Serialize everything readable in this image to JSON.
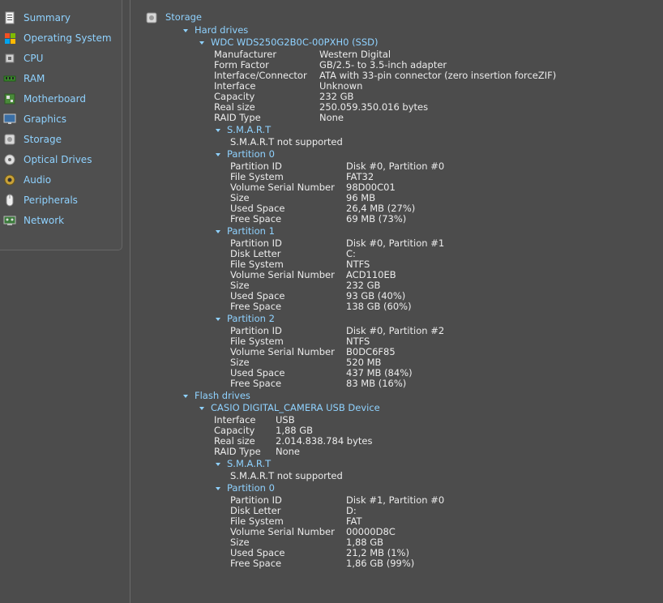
{
  "sidebar": {
    "items": [
      {
        "label": "Summary",
        "icon": "summary-icon"
      },
      {
        "label": "Operating System",
        "icon": "windows-icon"
      },
      {
        "label": "CPU",
        "icon": "cpu-icon"
      },
      {
        "label": "RAM",
        "icon": "ram-icon"
      },
      {
        "label": "Motherboard",
        "icon": "motherboard-icon"
      },
      {
        "label": "Graphics",
        "icon": "monitor-icon"
      },
      {
        "label": "Storage",
        "icon": "hard-drive-icon"
      },
      {
        "label": "Optical Drives",
        "icon": "optical-disc-icon"
      },
      {
        "label": "Audio",
        "icon": "speaker-icon"
      },
      {
        "label": "Peripherals",
        "icon": "mouse-icon"
      },
      {
        "label": "Network",
        "icon": "network-icon"
      }
    ]
  },
  "main": {
    "title": "Storage",
    "hard_drives": {
      "label": "Hard drives",
      "device": {
        "name": "WDC WDS250G2B0C-00PXH0 (SSD)",
        "props": [
          {
            "k": "Manufacturer",
            "v": "Western Digital"
          },
          {
            "k": "Form Factor",
            "v": "GB/2.5- to 3.5-inch adapter"
          },
          {
            "k": "Interface/Connector",
            "v": "ATA with 33-pin connector (zero insertion forceZIF)"
          },
          {
            "k": "Interface",
            "v": "Unknown"
          },
          {
            "k": "Capacity",
            "v": "232 GB"
          },
          {
            "k": "Real size",
            "v": "250.059.350.016 bytes"
          },
          {
            "k": "RAID Type",
            "v": "None"
          }
        ],
        "smart": {
          "label": "S.M.A.R.T",
          "text": "S.M.A.R.T not supported"
        },
        "partitions": [
          {
            "label": "Partition 0",
            "props": [
              {
                "k": "Partition ID",
                "v": "Disk #0, Partition #0"
              },
              {
                "k": "File System",
                "v": "FAT32"
              },
              {
                "k": "Volume Serial Number",
                "v": "98D00C01"
              },
              {
                "k": "Size",
                "v": "96 MB"
              },
              {
                "k": "Used Space",
                "v": "26,4 MB (27%)"
              },
              {
                "k": "Free Space",
                "v": "69 MB (73%)"
              }
            ]
          },
          {
            "label": "Partition 1",
            "props": [
              {
                "k": "Partition ID",
                "v": "Disk #0, Partition #1"
              },
              {
                "k": "Disk Letter",
                "v": "C:"
              },
              {
                "k": "File System",
                "v": "NTFS"
              },
              {
                "k": "Volume Serial Number",
                "v": "ACD110EB"
              },
              {
                "k": "Size",
                "v": "232 GB"
              },
              {
                "k": "Used Space",
                "v": "93 GB (40%)"
              },
              {
                "k": "Free Space",
                "v": "138 GB (60%)"
              }
            ]
          },
          {
            "label": "Partition 2",
            "props": [
              {
                "k": "Partition ID",
                "v": "Disk #0, Partition #2"
              },
              {
                "k": "File System",
                "v": "NTFS"
              },
              {
                "k": "Volume Serial Number",
                "v": "B0DC6F85"
              },
              {
                "k": "Size",
                "v": "520 MB"
              },
              {
                "k": "Used Space",
                "v": "437 MB (84%)"
              },
              {
                "k": "Free Space",
                "v": "83 MB (16%)"
              }
            ]
          }
        ]
      }
    },
    "flash_drives": {
      "label": "Flash drives",
      "device": {
        "name": "CASIO DIGITAL_CAMERA USB Device",
        "props": [
          {
            "k": "Interface",
            "v": "USB"
          },
          {
            "k": "Capacity",
            "v": "1,88 GB"
          },
          {
            "k": "Real size",
            "v": "2.014.838.784 bytes"
          },
          {
            "k": "RAID Type",
            "v": "None"
          }
        ],
        "smart": {
          "label": "S.M.A.R.T",
          "text": "S.M.A.R.T not supported"
        },
        "partitions": [
          {
            "label": "Partition 0",
            "props": [
              {
                "k": "Partition ID",
                "v": "Disk #1, Partition #0"
              },
              {
                "k": "Disk Letter",
                "v": "D:"
              },
              {
                "k": "File System",
                "v": "FAT"
              },
              {
                "k": "Volume Serial Number",
                "v": "00000D8C"
              },
              {
                "k": "Size",
                "v": "1,88 GB"
              },
              {
                "k": "Used Space",
                "v": "21,2 MB (1%)"
              },
              {
                "k": "Free Space",
                "v": "1,86 GB (99%)"
              }
            ]
          }
        ]
      }
    }
  }
}
